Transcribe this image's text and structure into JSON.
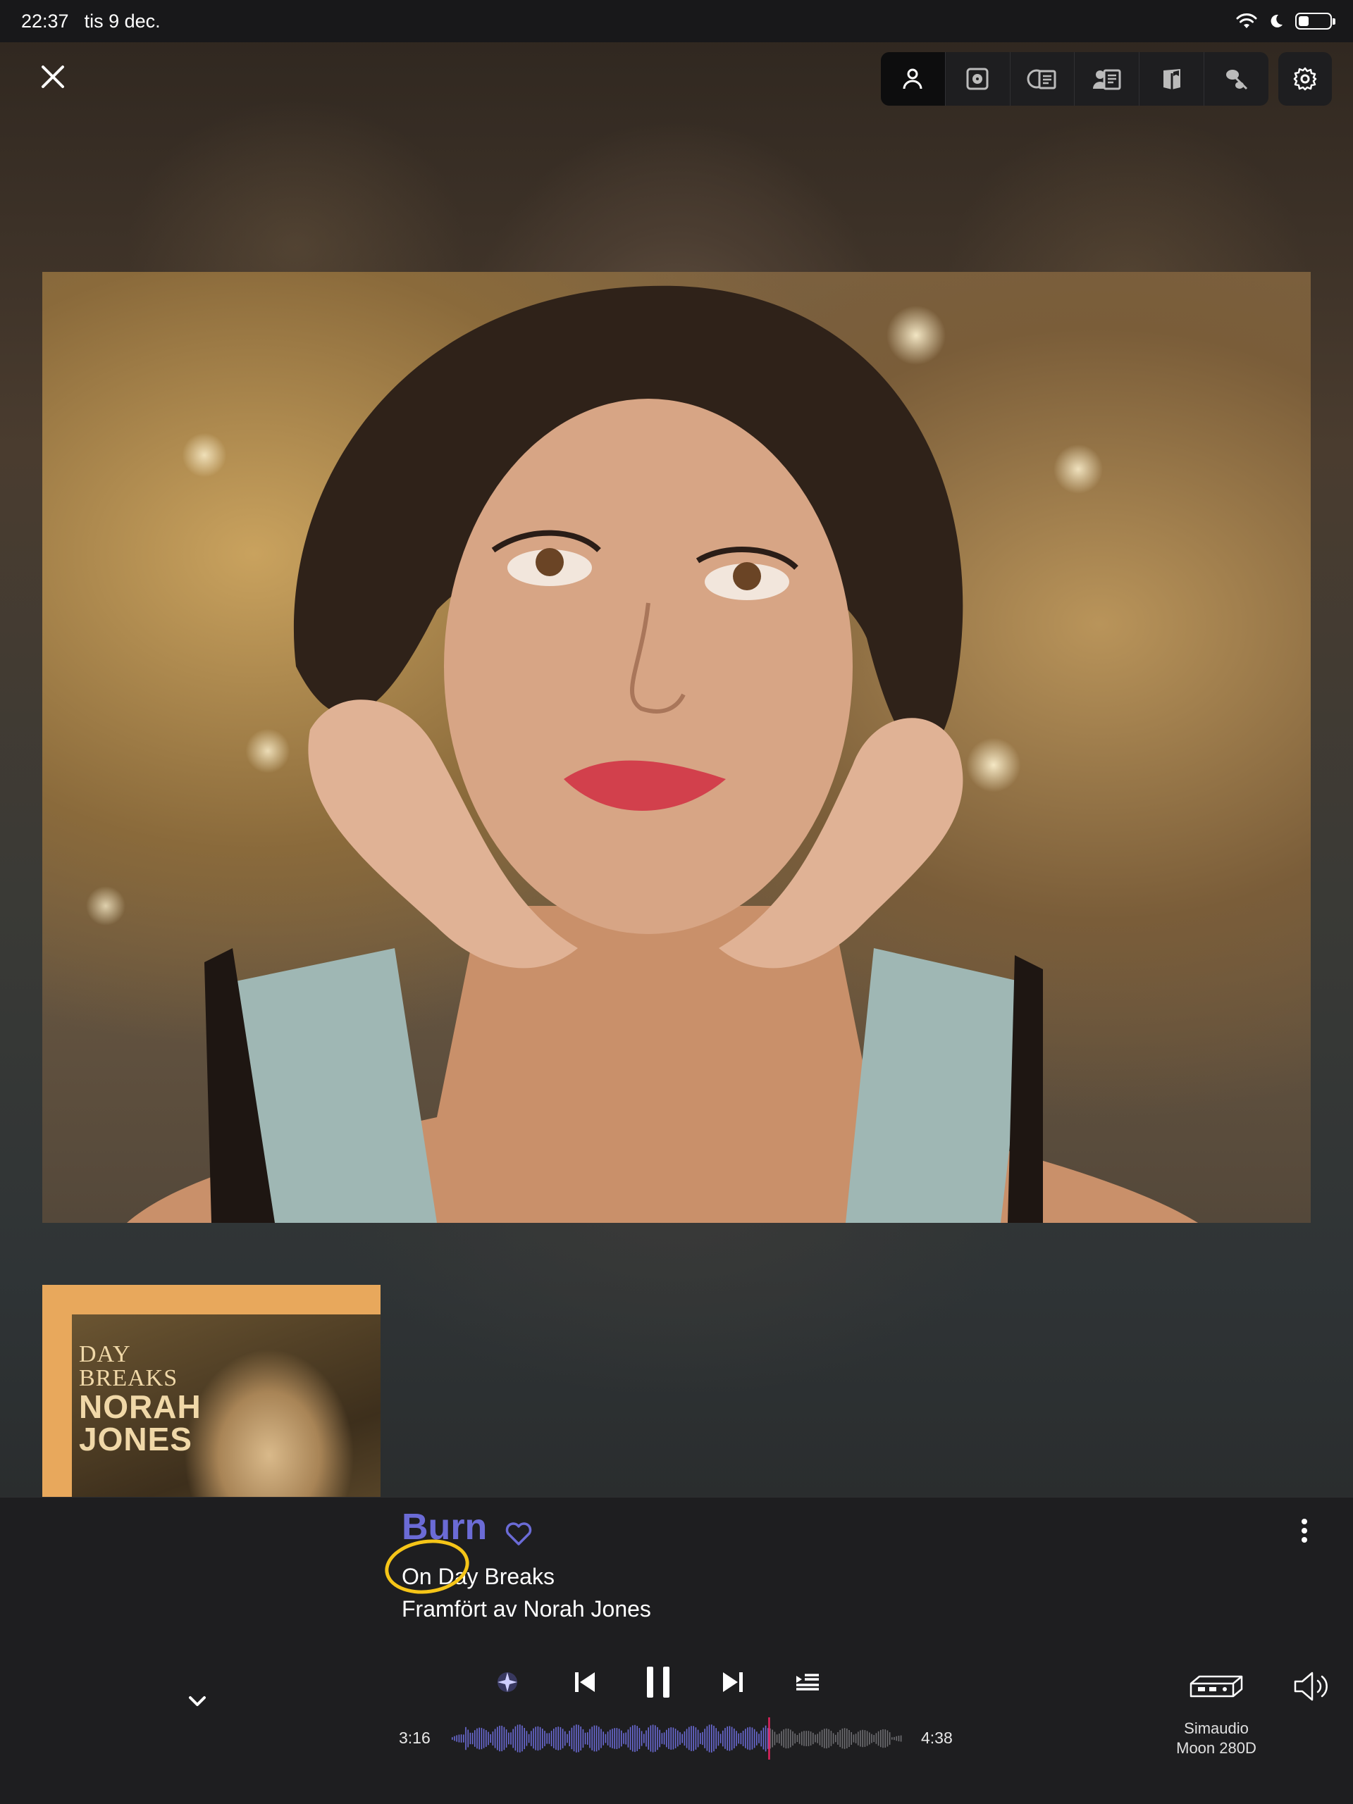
{
  "status_bar": {
    "time": "22:37",
    "date": "tis 9 dec."
  },
  "toolbar": {
    "items": [
      {
        "icon": "person-icon",
        "active": true
      },
      {
        "icon": "record-icon",
        "active": false
      },
      {
        "icon": "cd-document-icon",
        "active": false
      },
      {
        "icon": "person-document-icon",
        "active": false
      },
      {
        "icon": "book-icon",
        "active": false
      },
      {
        "icon": "guitar-icon",
        "active": false
      }
    ],
    "settings_icon": "gear-icon"
  },
  "now_playing": {
    "title": "Burn",
    "album": "On Day Breaks",
    "performer": "Framfört av Norah Jones",
    "favorite": false
  },
  "album_art": {
    "line1": "Day",
    "line2": "Breaks",
    "line3": "Norah",
    "line4": "Jones"
  },
  "playback": {
    "elapsed": "3:16",
    "total": "4:38",
    "progress": 0.705,
    "state": "playing"
  },
  "output_device": {
    "brand": "Simaudio",
    "model": "Moon 280D"
  },
  "colors": {
    "accent": "#6b6bd6",
    "panel": "#1e1e20",
    "annotation": "#f5c518",
    "playhead": "#e0245e"
  }
}
